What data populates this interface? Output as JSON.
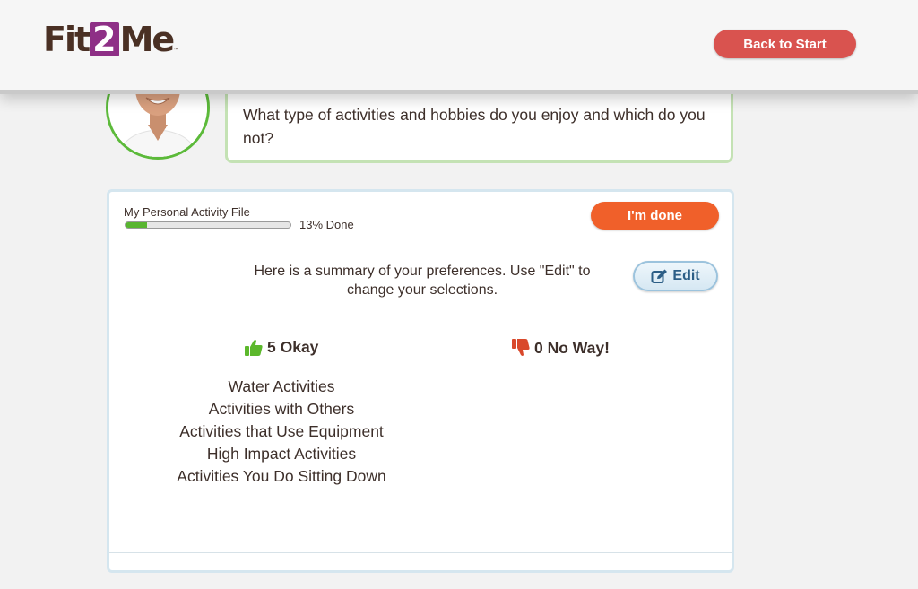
{
  "header": {
    "logo": {
      "part1": "Fit",
      "part2": "2",
      "part3": "Me",
      "tm": "™"
    },
    "back_button": "Back to Start"
  },
  "coach": {
    "question": "What type of activities and hobbies do you enjoy and which do you not?"
  },
  "activity_file": {
    "label": "My Personal Activity File",
    "progress_percent": 13,
    "progress_text": "13% Done",
    "done_button": "I'm done",
    "summary": "Here is a summary of your preferences. Use \"Edit\" to change your selections.",
    "edit_button": "Edit",
    "okay_heading": "5 Okay",
    "noway_heading": "0 No Way!",
    "okay_items": [
      "Water Activities",
      "Activities with Others",
      "Activities that Use Equipment",
      "High Impact Activities",
      "Activities You Do Sitting Down"
    ],
    "noway_items": []
  },
  "colors": {
    "brand_purple": "#8e2f86",
    "back_button": "#d9534f",
    "done_button": "#f0602a",
    "progress_green": "#58b530",
    "thumbs_up": "#5cb82c",
    "thumbs_down": "#d9482b"
  },
  "icons": {
    "okay": "thumbs-up-icon",
    "noway": "thumbs-down-icon",
    "edit": "edit-pencil-icon"
  }
}
